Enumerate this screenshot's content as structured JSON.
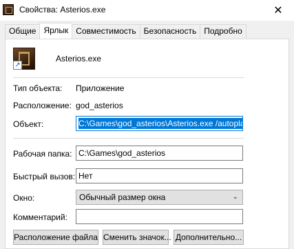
{
  "window": {
    "title": "Свойства: Asterios.exe",
    "close_glyph": "✕"
  },
  "tabs": [
    {
      "label": "Общие",
      "active": false
    },
    {
      "label": "Ярлык",
      "active": true
    },
    {
      "label": "Совместимость",
      "active": false
    },
    {
      "label": "Безопасность",
      "active": false
    },
    {
      "label": "Подробно",
      "active": false
    }
  ],
  "shortcut": {
    "name": "Asterios.exe",
    "type_label": "Тип объекта:",
    "type_value": "Приложение",
    "location_label": "Расположение:",
    "location_value": "god_asterios",
    "target_label": "Объект:",
    "target_value": "C:\\Games\\god_asterios\\Asterios.exe /autoplay",
    "workdir_label": "Рабочая папка:",
    "workdir_value": "C:\\Games\\god_asterios",
    "hotkey_label": "Быстрый вызов:",
    "hotkey_value": "Нет",
    "window_label": "Окно:",
    "window_value": "Обычный размер окна",
    "comment_label": "Комментарий:",
    "comment_value": ""
  },
  "buttons": {
    "file_location": "Расположение файла",
    "change_icon": "Сменить значок...",
    "advanced": "Дополнительно..."
  },
  "icons": {
    "app": "asterios-app-icon",
    "shortcut": "shortcut-arrow-icon",
    "dropdown": "chevron-down-icon"
  }
}
